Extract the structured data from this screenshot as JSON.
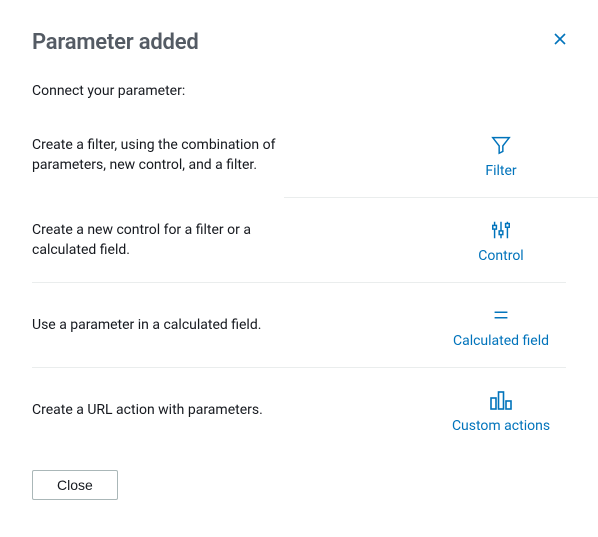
{
  "title": "Parameter added",
  "subtitle": "Connect your parameter:",
  "options": [
    {
      "desc": "Create a filter, using the combination of parameters, new control, and a filter.",
      "label": "Filter"
    },
    {
      "desc": "Create a new control for a filter or a calculated field.",
      "label": "Control"
    },
    {
      "desc": "Use a parameter in a calculated field.",
      "label": "Calculated field"
    },
    {
      "desc": "Create a URL action with parameters.",
      "label": "Custom actions"
    }
  ],
  "close_button": "Close"
}
